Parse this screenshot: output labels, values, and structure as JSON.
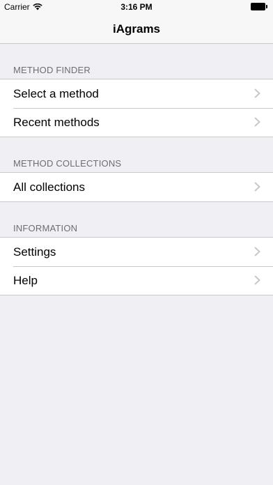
{
  "status_bar": {
    "carrier": "Carrier",
    "time": "3:16 PM"
  },
  "nav": {
    "title": "iAgrams"
  },
  "sections": [
    {
      "header": "METHOD FINDER",
      "items": [
        {
          "label": "Select a method"
        },
        {
          "label": "Recent methods"
        }
      ]
    },
    {
      "header": "METHOD COLLECTIONS",
      "items": [
        {
          "label": "All collections"
        }
      ]
    },
    {
      "header": "INFORMATION",
      "items": [
        {
          "label": "Settings"
        },
        {
          "label": "Help"
        }
      ]
    }
  ]
}
